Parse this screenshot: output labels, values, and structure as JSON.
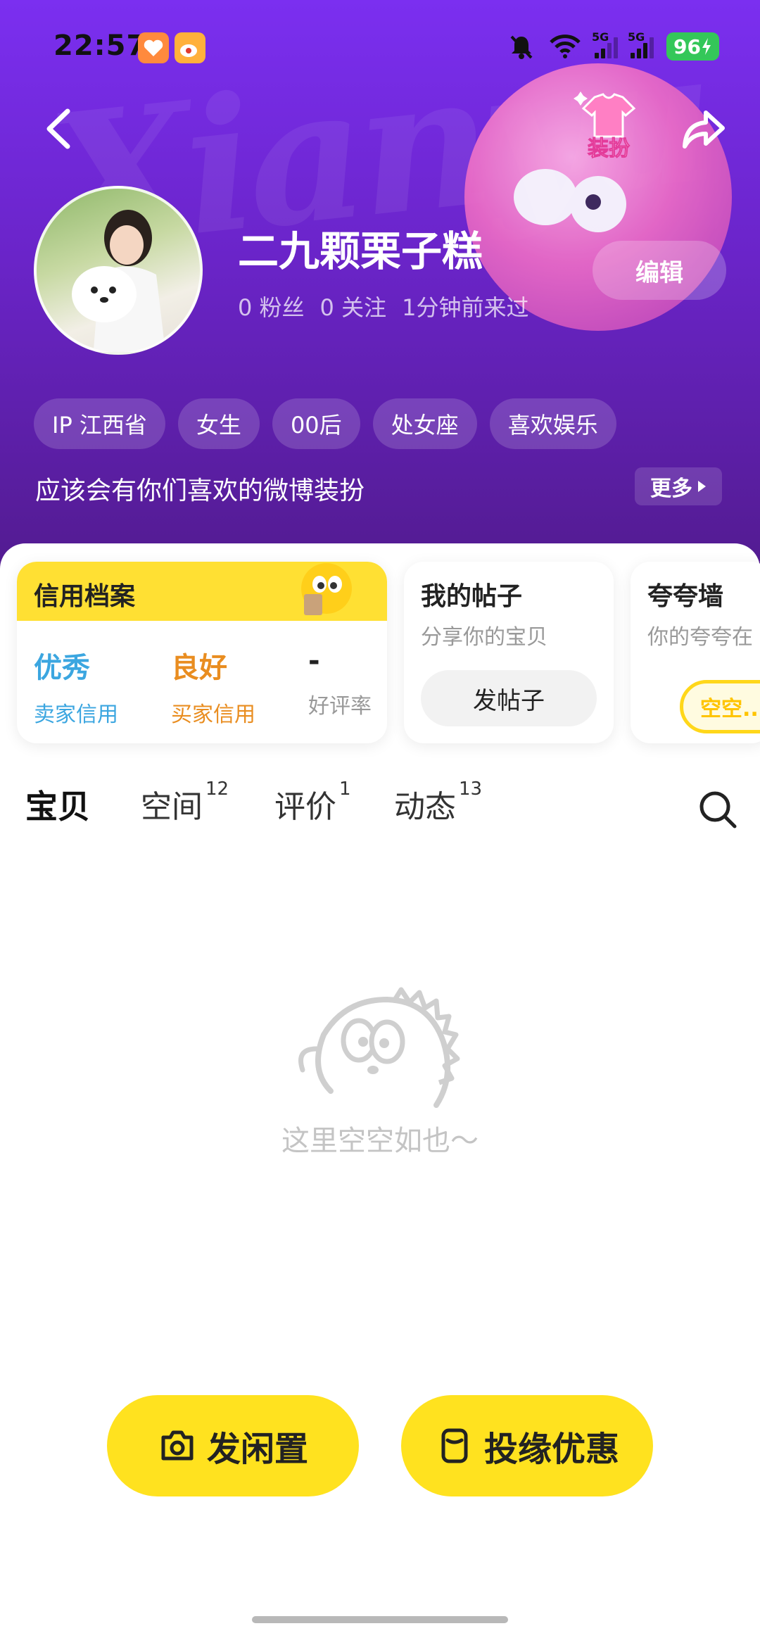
{
  "status_bar": {
    "time": "22:57",
    "signal_1": "5G",
    "signal_2": "5G",
    "battery": "96"
  },
  "profile": {
    "name": "二九颗栗子糕",
    "followers": "0 粉丝",
    "following": "0 关注",
    "last_seen": "1分钟前来过",
    "edit_label": "编辑",
    "dress_label": "装扮",
    "watermark": "Xianyu",
    "tags": [
      "IP 江西省",
      "女生",
      "00后",
      "处女座",
      "喜欢娱乐"
    ],
    "bio": "应该会有你们喜欢的微博装扮",
    "more_label": "更多"
  },
  "cards": {
    "credit": {
      "title": "信用档案",
      "seller_value": "优秀",
      "seller_label": "卖家信用",
      "buyer_value": "良好",
      "buyer_label": "买家信用",
      "rate_value": "-",
      "rate_label": "好评率"
    },
    "posts": {
      "title": "我的帖子",
      "subtitle": "分享你的宝贝",
      "button": "发帖子"
    },
    "praise": {
      "title": "夸夸墙",
      "subtitle": "你的夸夸在",
      "bubble": "空空..."
    }
  },
  "tabs": [
    {
      "label": "宝贝",
      "count": ""
    },
    {
      "label": "空间",
      "count": "12"
    },
    {
      "label": "评价",
      "count": "1"
    },
    {
      "label": "动态",
      "count": "13"
    }
  ],
  "empty_state": "这里空空如也～",
  "actions": {
    "publish": "发闲置",
    "promo": "投缘优惠"
  },
  "colors": {
    "header_purple": "#6a24c8",
    "accent_yellow": "#ffe21f",
    "seller_blue": "#3ba6e0",
    "buyer_orange": "#e98d20"
  }
}
